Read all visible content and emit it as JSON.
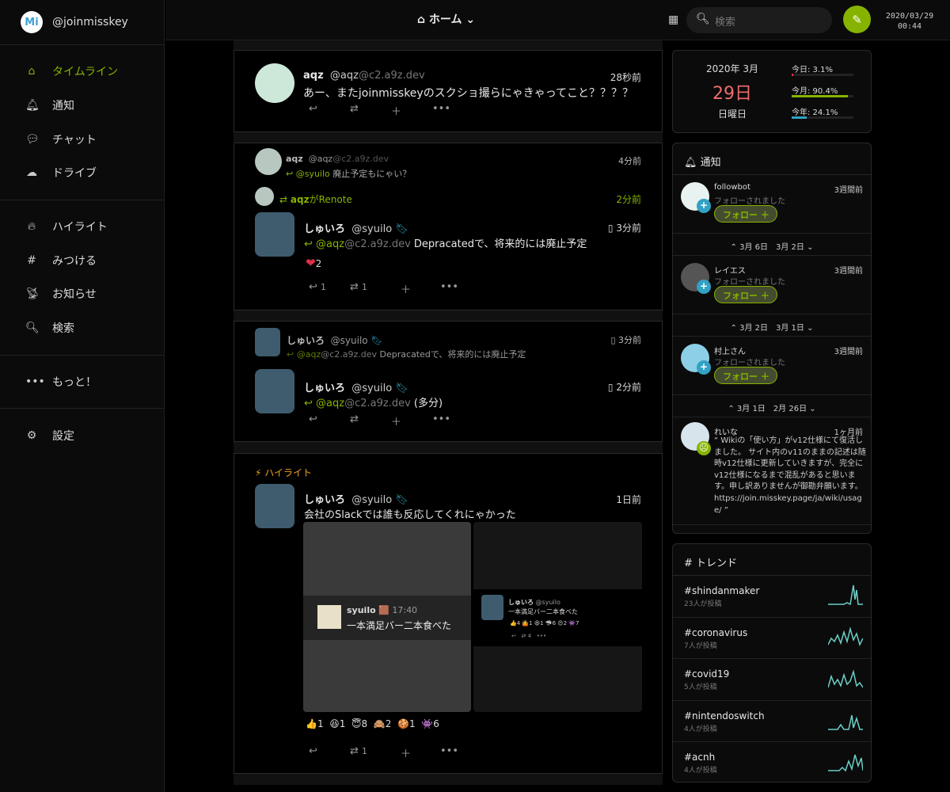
{
  "account": {
    "logo": "Mi",
    "handle": "@joinmisskey"
  },
  "nav": [
    {
      "label": "タイムライン",
      "icon": "home-icon"
    },
    {
      "label": "通知",
      "icon": "bell-icon"
    },
    {
      "label": "チャット",
      "icon": "chat-icon"
    },
    {
      "label": "ドライブ",
      "icon": "cloud-icon"
    }
  ],
  "nav2": [
    {
      "label": "ハイライト",
      "icon": "fire-icon"
    },
    {
      "label": "みつける",
      "icon": "hashtag-icon"
    },
    {
      "label": "お知らせ",
      "icon": "broadcast-icon"
    },
    {
      "label": "検索",
      "icon": "search-icon"
    }
  ],
  "more": "もっと！",
  "settings": "設定",
  "topbar": {
    "title": "ホーム",
    "search_placeholder": "検索",
    "date": "2020/03/29",
    "time": "00:44"
  },
  "notes": {
    "n1": {
      "name": "aqz",
      "user": "@aqz",
      "host": "@c2.a9z.dev",
      "time": "28秒前",
      "text": "あー、またjoinmisskeyのスクショ撮らにゃきゃってこと？？？？"
    },
    "n2": {
      "pname": "aqz",
      "puser": "@aqz",
      "phost": "@c2.a9z.dev",
      "ptime": "4分前",
      "preply": "@syuilo",
      "ptext": "廃止予定もにゃい？",
      "renoter": "aqz",
      "renote_suffix": "がRenote",
      "rtime": "2分前",
      "name": "しゅいろ",
      "user": "@syuilo",
      "time": "3分前",
      "reply_user": "@aqz",
      "reply_host": "@c2.a9z.dev",
      "text": "Depracatedで、将来的には廃止予定",
      "reaction_count": "2",
      "reply_count": "1",
      "renote_count": "1"
    },
    "n3": {
      "pname": "しゅいろ",
      "puser": "@syuilo",
      "ptime": "3分前",
      "preply": "@aqz",
      "phost": "@c2.a9z.dev",
      "ptext": "Depracatedで、将来的には廃止予定",
      "name": "しゅいろ",
      "user": "@syuilo",
      "time": "2分前",
      "reply_user": "@aqz",
      "reply_host": "@c2.a9z.dev",
      "text": "(多分)"
    },
    "n4": {
      "label": "ハイライト",
      "name": "しゅいろ",
      "user": "@syuilo",
      "time": "1日前",
      "text": "会社のSlackでは誰も反応してくれにゃかった",
      "slack_user": "syuilo",
      "slack_time": "17:40",
      "slack_text": "一本満足バー二本食べた",
      "mini_name": "しゅいろ",
      "mini_user": "@syuilo",
      "mini_text": "一本満足バー二本食べた",
      "mini_reacts": [
        "4",
        "1",
        "1",
        "6",
        "2",
        "7"
      ],
      "mini_renote": "4",
      "reactions": [
        {
          "e": "👍",
          "c": "1"
        },
        {
          "e": "😆",
          "c": "1"
        },
        {
          "e": "😇",
          "c": "8"
        },
        {
          "e": "🙈",
          "c": "2"
        },
        {
          "e": "🍪",
          "c": "1"
        },
        {
          "e": "👾",
          "c": "6"
        }
      ],
      "renote_count": "1"
    }
  },
  "calendar": {
    "ym": "2020年 3月",
    "day": "29日",
    "weekday": "日曜日",
    "today": "今日: 3.1%",
    "month": "今月: 90.4%",
    "year": "今年: 24.1%",
    "today_pct": 3.1,
    "month_pct": 90.4,
    "year_pct": 24.1
  },
  "notifications": {
    "title": "通知",
    "items": [
      {
        "name": "followbot",
        "sub": "フォローされました",
        "time": "3週間前",
        "btn": "フォロー ＋"
      },
      {
        "name": "レイエス",
        "sub": "フォローされました",
        "time": "3週間前",
        "btn": "フォロー ＋"
      },
      {
        "name": "村上さん",
        "sub": "フォローされました",
        "time": "3週間前",
        "btn": "フォロー ＋"
      }
    ],
    "seps": [
      "3月 6日　3月 2日",
      "3月 2日　3月 1日",
      "3月 1日　2月 26日"
    ],
    "last": {
      "name": "れいな",
      "time": "1ヶ月前",
      "text": "“ Wikiの「使い方」がv12仕様にて復活しました。 サイト内のv11のままの記述は随時v12仕様に更新していきますが、完全にv12仕様になるまで混乱があると思います。申し訳ありませんが御勘弁願います。 https://join.misskey.page/ja/wiki/usage/ ”"
    }
  },
  "trends": {
    "title": "トレンド",
    "items": [
      {
        "tag": "#shindanmaker",
        "count": "23人が投稿"
      },
      {
        "tag": "#coronavirus",
        "count": "7人が投稿"
      },
      {
        "tag": "#covid19",
        "count": "5人が投稿"
      },
      {
        "tag": "#nintendoswitch",
        "count": "4人が投稿"
      },
      {
        "tag": "#acnh",
        "count": "4人が投稿"
      }
    ]
  }
}
